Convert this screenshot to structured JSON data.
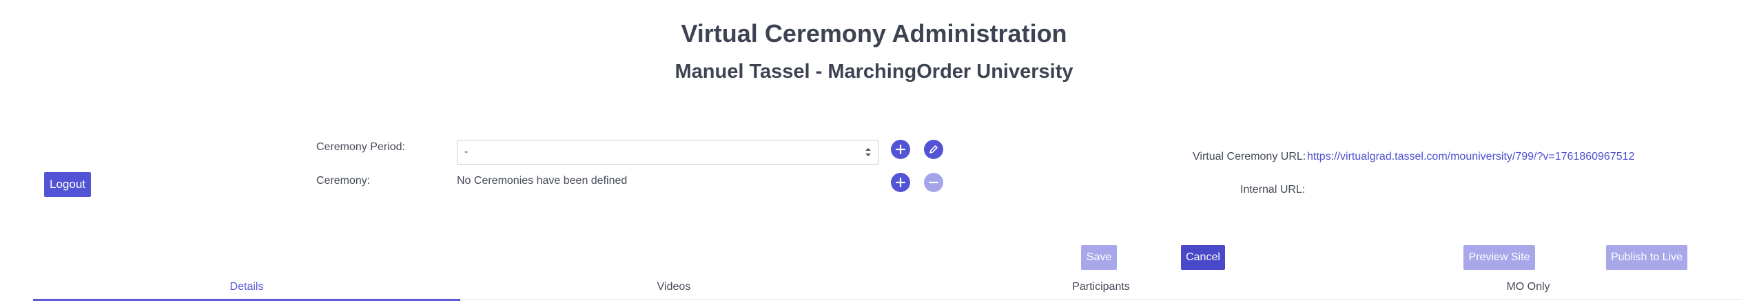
{
  "header": {
    "title": "Virtual Ceremony Administration",
    "subtitle": "Manuel Tassel - MarchingOrder University"
  },
  "logout_label": "Logout",
  "ceremony_period": {
    "label": "Ceremony Period:",
    "selected": "-"
  },
  "ceremony": {
    "label": "Ceremony:",
    "empty_text": "No Ceremonies have been defined"
  },
  "urls": {
    "virtual_label": "Virtual Ceremony URL:",
    "virtual_value": "https://virtualgrad.tassel.com/mouniversity/799/?v=1761860967512",
    "internal_label": "Internal URL:",
    "internal_value": ""
  },
  "actions": {
    "save": "Save",
    "cancel": "Cancel",
    "preview": "Preview Site",
    "publish": "Publish to Live"
  },
  "tabs": [
    {
      "label": "Details",
      "active": true
    },
    {
      "label": "Videos",
      "active": false
    },
    {
      "label": "Participants",
      "active": false
    },
    {
      "label": "MO Only",
      "active": false
    }
  ],
  "colors": {
    "accent": "#5353d6",
    "accent_disabled": "#a7a7ea",
    "text": "#454a58",
    "heading": "#3d4352",
    "link": "#4d4fcf"
  },
  "icons": {
    "add_period": "plus-icon",
    "edit_period": "pencil-icon",
    "add_ceremony": "plus-icon",
    "remove_ceremony": "minus-icon",
    "select_arrows": "updown-chevron-icon"
  }
}
